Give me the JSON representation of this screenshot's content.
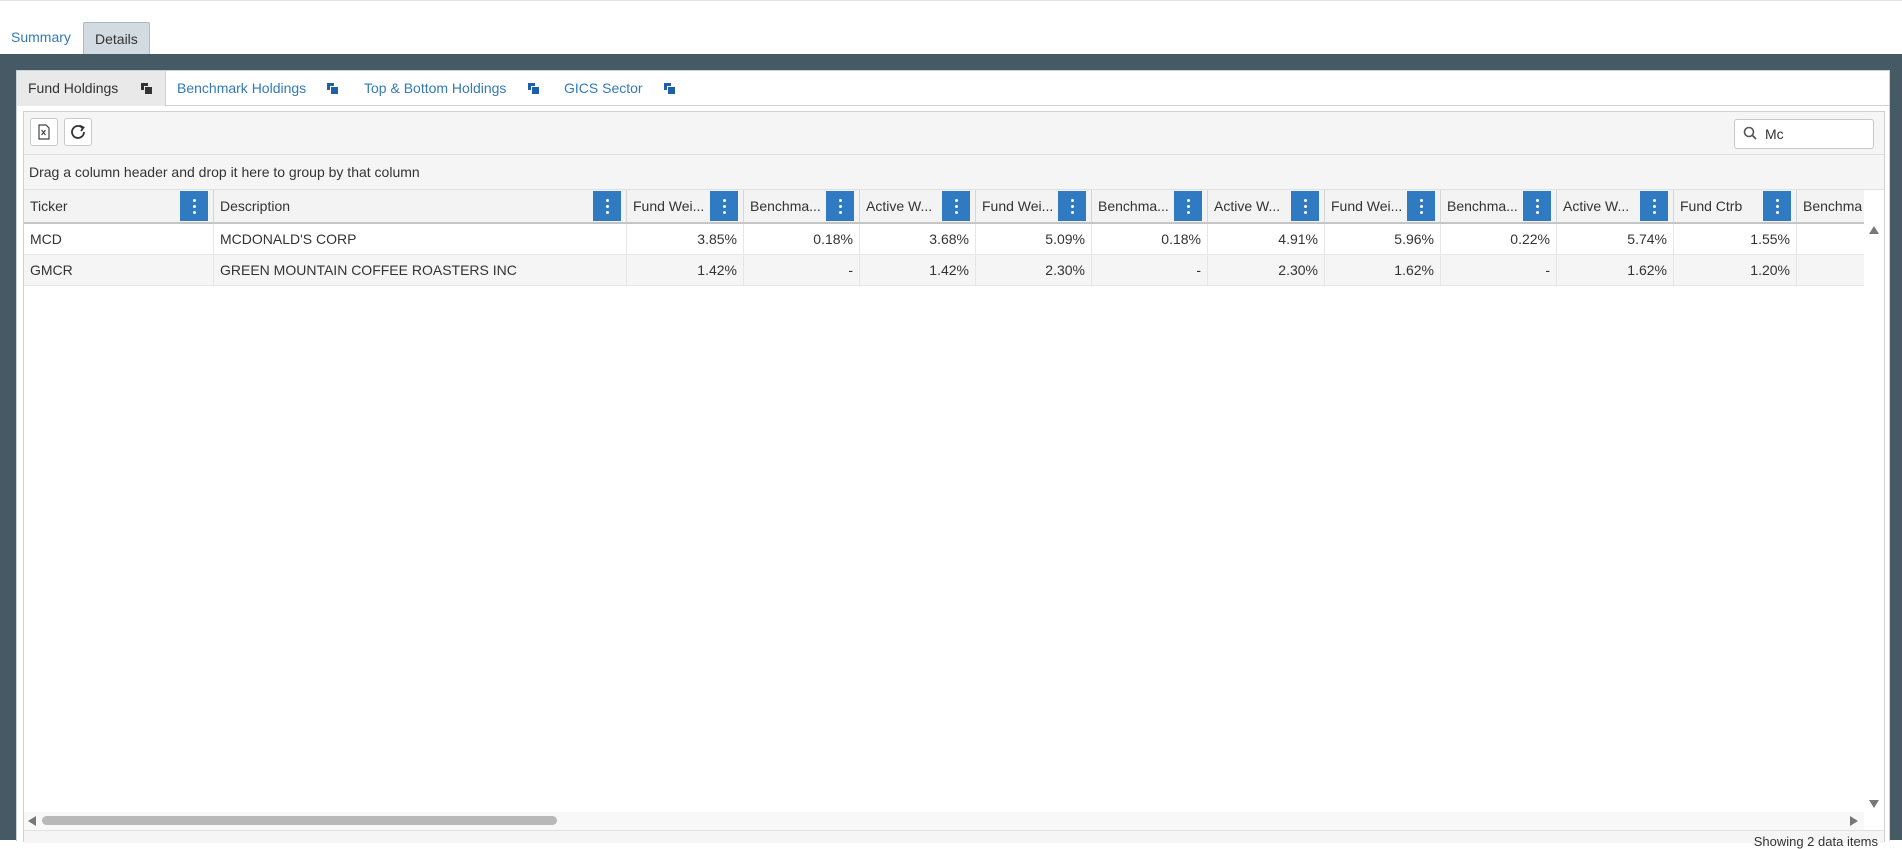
{
  "top_tabs": [
    {
      "label": "Summary",
      "active": false
    },
    {
      "label": "Details",
      "active": true
    }
  ],
  "sub_tabs": [
    {
      "label": "Fund Holdings",
      "active": true,
      "icon": "copy-icon"
    },
    {
      "label": "Benchmark Holdings",
      "active": false,
      "icon": "copy-icon"
    },
    {
      "label": "Top & Bottom Holdings",
      "active": false,
      "icon": "copy-icon"
    },
    {
      "label": "GICS Sector",
      "active": false,
      "icon": "copy-icon"
    }
  ],
  "toolbar": {
    "export_icon": "excel-export-icon",
    "refresh_icon": "refresh-icon",
    "search_icon": "search-icon",
    "search_value": "Mc"
  },
  "group_panel_text": "Drag a column header and drop it here to group by that column",
  "columns": [
    "Ticker",
    "Description",
    "Fund Wei...",
    "Benchma...",
    "Active W...",
    "Fund Wei...",
    "Benchma...",
    "Active W...",
    "Fund Wei...",
    "Benchma...",
    "Active W...",
    "Fund Ctrb",
    "Benchma"
  ],
  "rows": [
    [
      "MCD",
      "MCDONALD'S CORP",
      "3.85%",
      "0.18%",
      "3.68%",
      "5.09%",
      "0.18%",
      "4.91%",
      "5.96%",
      "0.22%",
      "5.74%",
      "1.55%",
      ""
    ],
    [
      "GMCR",
      "GREEN MOUNTAIN COFFEE ROASTERS INC",
      "1.42%",
      "-",
      "1.42%",
      "2.30%",
      "-",
      "2.30%",
      "1.62%",
      "-",
      "1.62%",
      "1.20%",
      ""
    ]
  ],
  "footer_text": "Showing 2 data items",
  "colors": {
    "accent": "#2f7ac0",
    "link": "#337ab7",
    "frame": "#455a64",
    "active_tab": "#d3dbe2"
  }
}
